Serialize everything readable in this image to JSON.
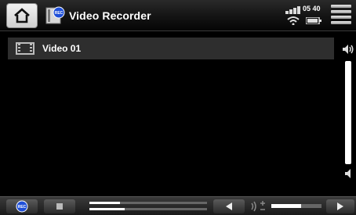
{
  "header": {
    "app_title": "Video Recorder",
    "app_icon_badge": "REC",
    "clock": "05 40",
    "icons": [
      "home-icon",
      "video-recorder-icon",
      "signal-icon",
      "wifi-icon",
      "battery-icon",
      "menu-icon"
    ]
  },
  "list": {
    "items": [
      {
        "label": "Video 01",
        "icon": "film-icon"
      }
    ]
  },
  "volume": {
    "level": 1.0
  },
  "bottombar": {
    "rec_label": "REC",
    "progress_top": 0.26,
    "progress_bottom": 0.3,
    "volume_bar": 0.6,
    "icons": [
      "rec-icon",
      "stop-icon",
      "prev-icon",
      "audio-fx-icon",
      "next-icon"
    ]
  },
  "colors": {
    "background": "#000000",
    "item_bg": "#2e2e2e",
    "rec_blue": "#1f4fd8"
  }
}
